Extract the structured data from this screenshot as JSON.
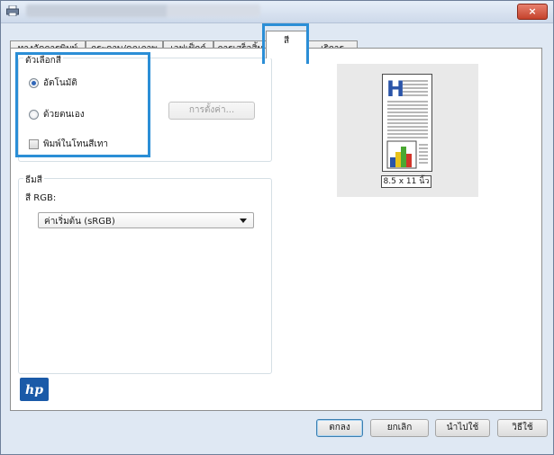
{
  "window": {
    "title": "",
    "close_label": "×"
  },
  "tabs": [
    {
      "label": "ทางลัดการพิมพ์"
    },
    {
      "label": "กระดาษ/คุณภาพ"
    },
    {
      "label": "เอฟเฟ็กต์"
    },
    {
      "label": "การเสร็จสิ้น"
    },
    {
      "label": "สี"
    },
    {
      "label": "เริการ"
    }
  ],
  "active_tab_index": 4,
  "color_options": {
    "legend": "ตัวเลือกสี",
    "auto_label": "อัตโนมัติ",
    "manual_label": "ด้วยตนเอง",
    "settings_button": "การตั้งค่า...",
    "grayscale_label": "พิมพ์ในโทนสีเทา",
    "selected": "auto",
    "grayscale_checked": false
  },
  "color_themes": {
    "legend": "ธีมสี",
    "rgb_label": "สี RGB:",
    "rgb_value": "ค่าเริ่มต้น (sRGB)"
  },
  "preview": {
    "paper_size": "8.5 x 11 นิ้ว"
  },
  "buttons": {
    "ok": "ตกลง",
    "cancel": "ยกเลิก",
    "apply": "นำไปใช้",
    "help": "วิธีใช้"
  },
  "colors": {
    "accent_highlight": "#2b8ed6",
    "chart_blue": "#2a54a8",
    "chart_green": "#4aa832",
    "chart_yellow": "#e8c21a",
    "chart_red": "#d2352a"
  },
  "icons": {
    "app": "printer-icon",
    "logo": "hp-logo-icon",
    "dropdown": "chevron-down-icon"
  }
}
